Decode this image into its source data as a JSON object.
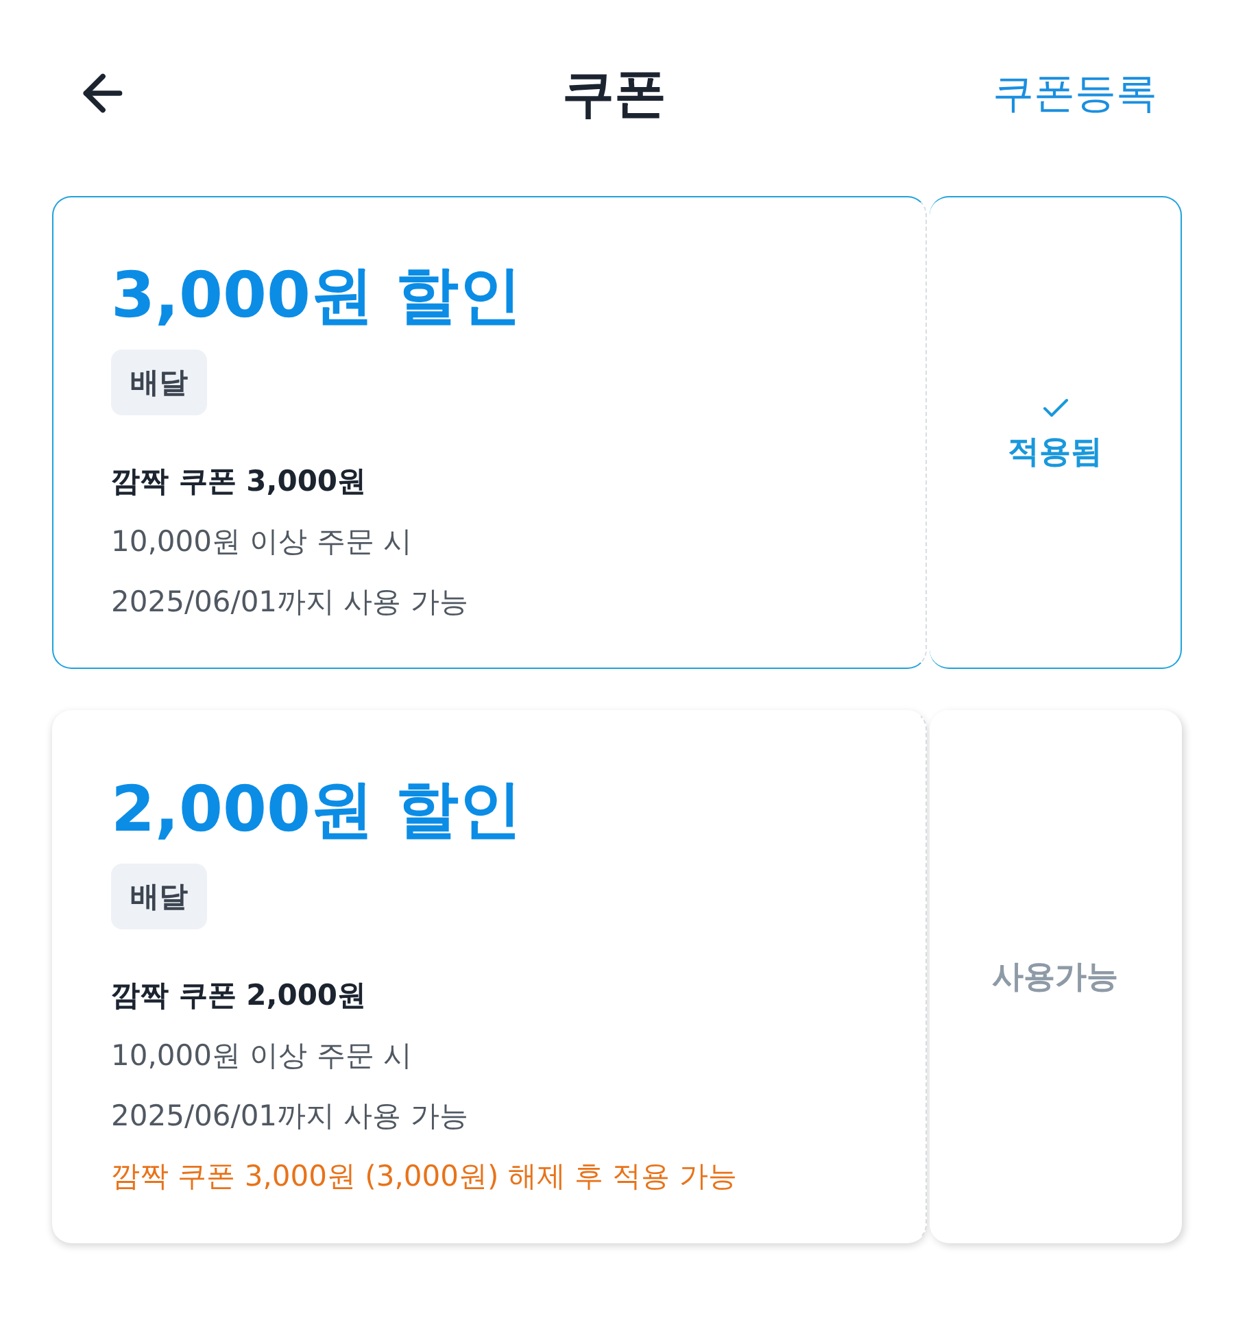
{
  "header": {
    "title": "쿠폰",
    "action": "쿠폰등록"
  },
  "coupons": [
    {
      "discount": "3,000원 할인",
      "tag": "배달",
      "name": "깜짝 쿠폰 3,000원",
      "condition": "10,000원 이상 주문 시",
      "expiry": "2025/06/01까지 사용 가능",
      "status": "적용됨",
      "selected": true
    },
    {
      "discount": "2,000원 할인",
      "tag": "배달",
      "name": "깜짝 쿠폰 2,000원",
      "condition": "10,000원 이상 주문 시",
      "expiry": "2025/06/01까지 사용 가능",
      "notice": "깜짝 쿠폰 3,000원 (3,000원) 해제 후 적용 가능",
      "status": "사용가능",
      "selected": false
    }
  ]
}
